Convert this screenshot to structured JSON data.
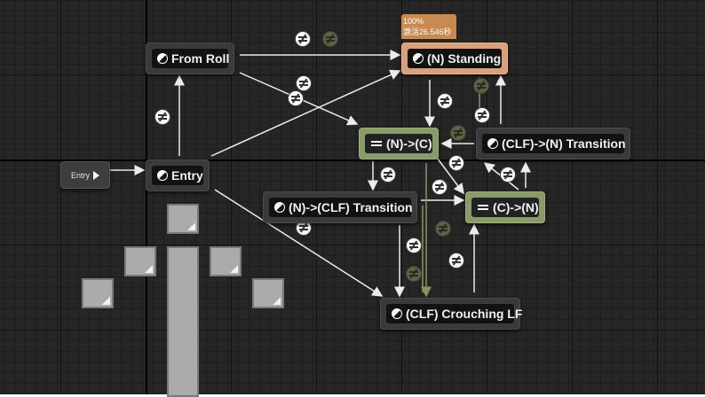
{
  "editor": {
    "entry_label": "Entry",
    "tooltip": {
      "line1": "100%",
      "line2": "激活26.546秒"
    },
    "states": {
      "from_roll": "From Roll",
      "n_standing": "(N) Standing",
      "entry": "Entry",
      "clf_to_n_transition": "(CLF)->(N) Transition",
      "n_to_clf_transition": "(N)->(CLF) Transition",
      "clf_crouching_lf": "(CLF) Crouching LF"
    },
    "conduits": {
      "n_to_c": "(N)->(C)",
      "c_to_n": "(C)->(N)"
    }
  },
  "colors": {
    "grid_background": "#262626",
    "active_state": "#d9a07a",
    "conduit_node": "#8b9a6a",
    "wire": "#e8e8e8"
  }
}
